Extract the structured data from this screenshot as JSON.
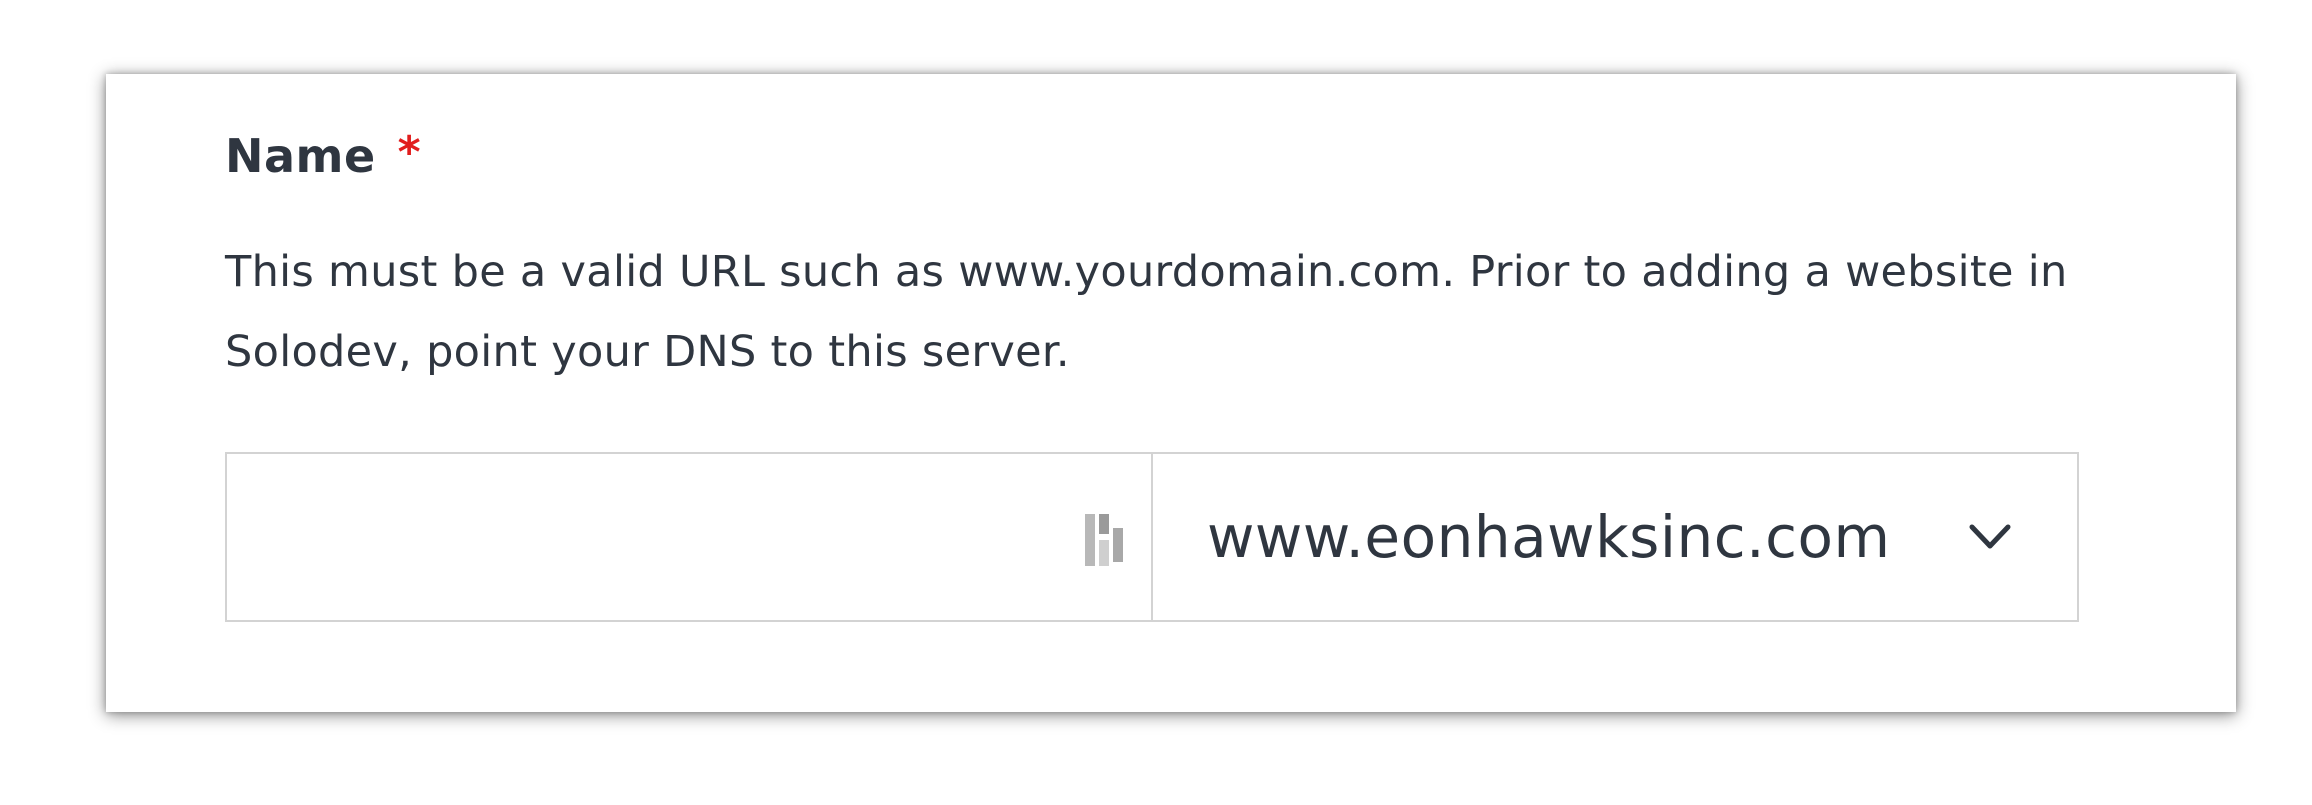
{
  "field": {
    "label": "Name",
    "required_marker": "*",
    "help_text": "This must be a valid URL such as www.yourdomain.com. Prior to adding a website in Solodev, point your DNS to this server."
  },
  "name_input": {
    "value": "",
    "placeholder": ""
  },
  "domain_select": {
    "selected": "www.eonhawksinc.com",
    "icon": "chevron-down-icon"
  },
  "autofill": {
    "icon": "password-manager-autofill-icon"
  },
  "colors": {
    "required": "#e11d1d",
    "text": "#2f3640",
    "border": "#d3d3d3"
  }
}
